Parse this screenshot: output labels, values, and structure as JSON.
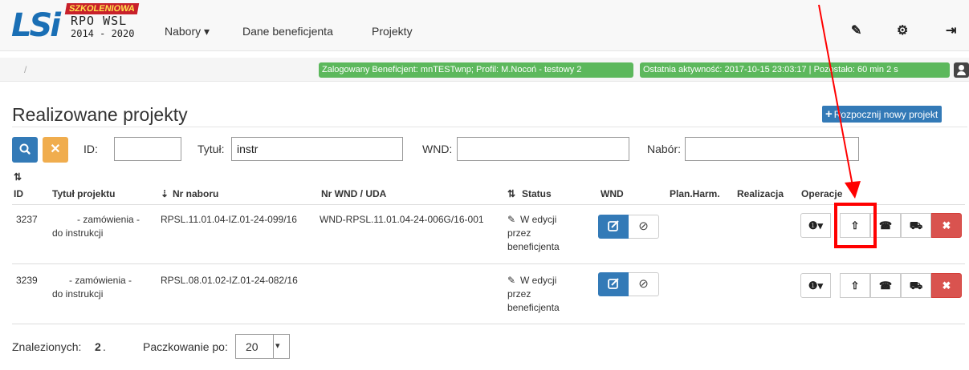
{
  "brand": {
    "ribbon": "SZKOLENIOWA",
    "logo_letters": "LSi",
    "line1": "RPO WSL",
    "line2": "2014 - 2020"
  },
  "nav": {
    "nabory": "Nabory ▾",
    "dane": "Dane beneficjenta",
    "projekty": "Projekty",
    "wrench": "✎",
    "gear": "⚙",
    "logout": "⇥"
  },
  "status": {
    "breadcrumb": "/",
    "logged": "Zalogowany Beneficjent: mnTESTwnp; Profil: M.Nocoń - testowy 2",
    "activity": "Ostatnia aktywność: 2017-10-15 23:03:17 | Pozostało: 60 min 2 s"
  },
  "page": {
    "title": "Realizowane projekty",
    "new_project": "Rozpocznij nowy projekt"
  },
  "filters": {
    "id_label": "ID:",
    "id_value": "",
    "title_label": "Tytuł:",
    "title_value": "instr",
    "wnd_label": "WND:",
    "wnd_value": "",
    "nabor_label": "Nabór:",
    "nabor_value": ""
  },
  "table": {
    "headers": {
      "id": "ID",
      "title": "Tytuł projektu",
      "nabor": "Nr naboru",
      "wnd_uda": "Nr WND / UDA",
      "status": "Status",
      "wnd": "WND",
      "plan": "Plan.Harm.",
      "realizacja": "Realizacja",
      "operacje": "Operacje"
    },
    "rows": [
      {
        "id": "3237",
        "title_line1": "- zamówienia -",
        "title_line2": "do instrukcji",
        "nabor": "RPSL.11.01.04-IZ.01-24-099/16",
        "wnd": "WND-RPSL.11.01.04-24-006G/16-001",
        "status_line1": "W edycji",
        "status_line2": "przez",
        "status_line3": "beneficjenta"
      },
      {
        "id": "3239",
        "title_line1": "- zamówienia -",
        "title_line2": "do instrukcji",
        "nabor": "RPSL.08.01.02-IZ.01-24-082/16",
        "wnd": "",
        "status_line1": "W edycji",
        "status_line2": "przez",
        "status_line3": "beneficjenta"
      }
    ]
  },
  "footer": {
    "found_label": "Znalezionych:",
    "found_count": "2",
    "found_dot": ".",
    "paging_label": "Paczkowanie po:",
    "paging_value": "20"
  },
  "colors": {
    "primary": "#337ab7",
    "warning": "#f0ad4e",
    "success": "#5cb85c",
    "danger": "#d9534f",
    "annotation": "#ff0000"
  }
}
